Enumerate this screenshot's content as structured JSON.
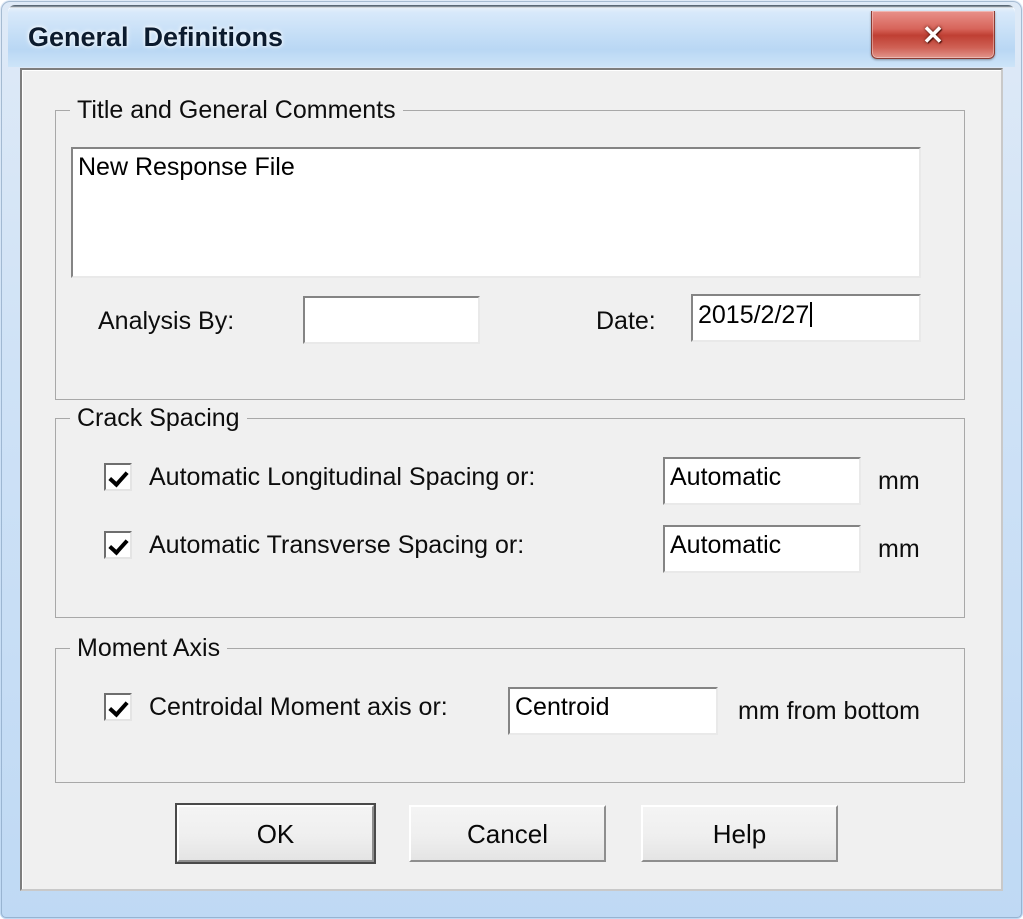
{
  "window": {
    "title": "General  Definitions",
    "close_button_label": "close-button",
    "close_glyph": "✕"
  },
  "groups": {
    "title_comments": {
      "legend": "Title and General Comments",
      "comments_value": "New Response File",
      "analysis_by": {
        "label": "Analysis By:",
        "value": ""
      },
      "date": {
        "label": "Date:",
        "value": "2015/2/27"
      }
    },
    "crack_spacing": {
      "legend": "Crack Spacing",
      "rows": [
        {
          "checkbox_label": "Automatic Longitudinal Spacing or:",
          "checked": true,
          "value": "Automatic",
          "unit": "mm"
        },
        {
          "checkbox_label": "Automatic Transverse Spacing or:",
          "checked": true,
          "value": "Automatic",
          "unit": "mm"
        }
      ]
    },
    "moment_axis": {
      "legend": "Moment Axis",
      "rows": [
        {
          "checkbox_label": "Centroidal Moment axis or:",
          "checked": true,
          "value": "Centroid",
          "unit": "mm from bottom"
        }
      ]
    }
  },
  "buttons": {
    "ok": "OK",
    "cancel": "Cancel",
    "help": "Help"
  },
  "colors": {
    "dialog_face": "#f0f0f0",
    "titlebar_blue": "#c3ddf6",
    "close_red": "#bf3f33",
    "field_white": "#ffffff",
    "text": "#0d0d0d"
  }
}
